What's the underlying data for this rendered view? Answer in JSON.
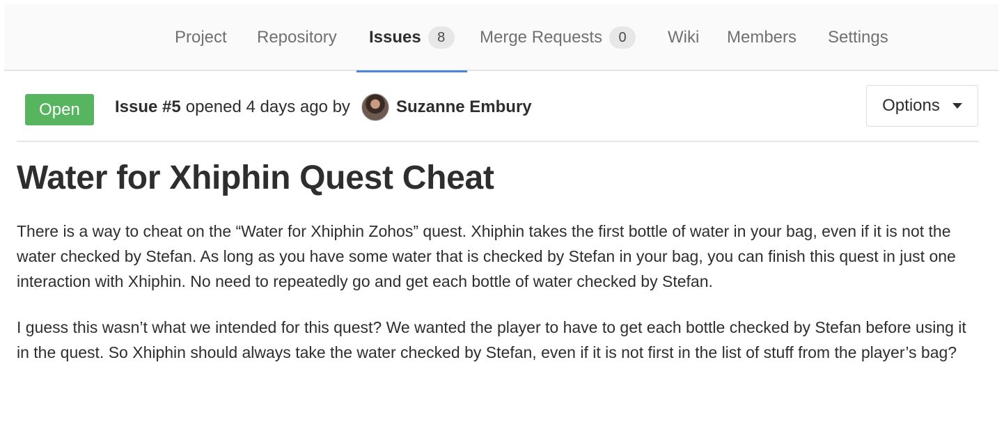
{
  "nav": {
    "items": [
      {
        "label": "Project"
      },
      {
        "label": "Repository"
      },
      {
        "label": "Issues",
        "count": "8"
      },
      {
        "label": "Merge Requests",
        "count": "0"
      },
      {
        "label": "Wiki"
      },
      {
        "label": "Members"
      },
      {
        "label": "Settings"
      }
    ],
    "active": "Issues"
  },
  "issue": {
    "status": "Open",
    "number_label": "Issue #5",
    "opened_text": "opened 4 days ago by",
    "author": "Suzanne Embury",
    "options_label": "Options",
    "title": "Water for Xhiphin Quest Cheat",
    "paragraphs": [
      "There is a way to cheat on the “Water for Xhiphin Zohos” quest. Xhiphin takes the first bottle of water in your bag, even if it is not the water checked by Stefan. As long as you have some water that is checked by Stefan in your bag, you can finish this quest in just one interaction with Xhiphin. No need to repeatedly go and get each bottle of water checked by Stefan.",
      "I guess this wasn’t what we intended for this quest? We wanted the player to have to get each bottle checked by Stefan before using it in the quest. So Xhiphin should always take the water checked by Stefan, even if it is not first in the list of stuff from the player’s bag?"
    ]
  },
  "colors": {
    "status_open": "#57b45f",
    "active_tab_underline": "#4a86d4"
  }
}
